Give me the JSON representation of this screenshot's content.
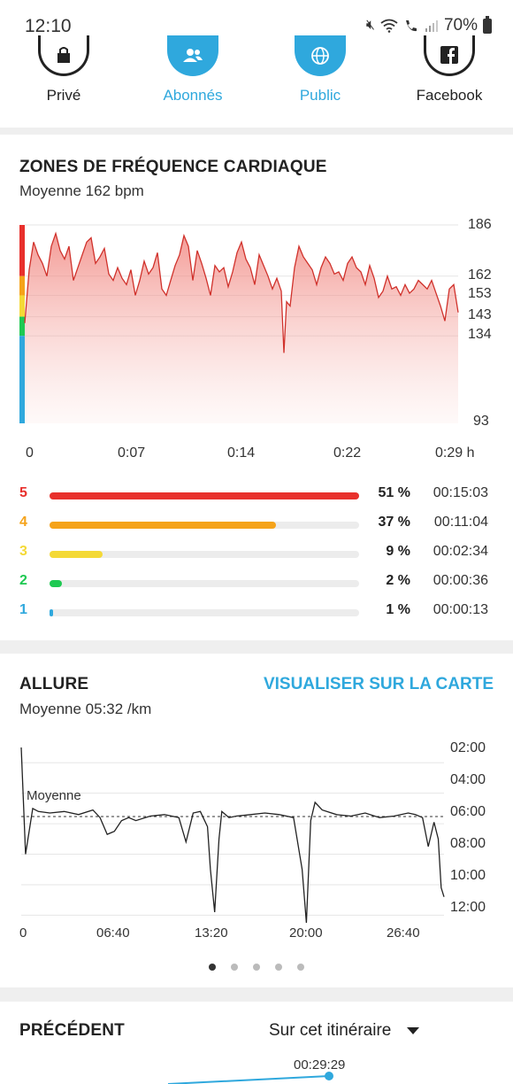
{
  "status": {
    "time": "12:10",
    "battery": "70%"
  },
  "share": {
    "items": [
      {
        "label": "Privé",
        "color": "#222222"
      },
      {
        "label": "Abonnés",
        "color": "#2fa8dd"
      },
      {
        "label": "Public",
        "color": "#2fa8dd"
      },
      {
        "label": "Facebook",
        "color": "#222222"
      }
    ]
  },
  "heart_rate": {
    "title": "ZONES DE FRÉQUENCE CARDIAQUE",
    "subtitle": "Moyenne 162 bpm",
    "y_ticks": [
      "186",
      "162",
      "153",
      "143",
      "134",
      "93"
    ],
    "x_ticks": [
      "0",
      "0:07",
      "0:14",
      "0:22",
      "0:29 h"
    ],
    "zones": [
      {
        "num": "5",
        "pct": "51 %",
        "time": "00:15:03",
        "fraction": 1.0,
        "color": "#e8302c"
      },
      {
        "num": "4",
        "pct": "37 %",
        "time": "00:11:04",
        "fraction": 0.73,
        "color": "#f5a31a"
      },
      {
        "num": "3",
        "pct": "9 %",
        "time": "00:02:34",
        "fraction": 0.17,
        "color": "#f4d936"
      },
      {
        "num": "2",
        "pct": "2 %",
        "time": "00:00:36",
        "fraction": 0.04,
        "color": "#1ec952"
      },
      {
        "num": "1",
        "pct": "1 %",
        "time": "00:00:13",
        "fraction": 0.01,
        "color": "#2fa8dd"
      }
    ]
  },
  "pace": {
    "title": "ALLURE",
    "link": "VISUALISER SUR LA CARTE",
    "subtitle": "Moyenne 05:32 /km",
    "avg_label": "Moyenne",
    "y_ticks": [
      "02:00",
      "04:00",
      "06:00",
      "08:00",
      "10:00",
      "12:00"
    ],
    "x_ticks": [
      "0",
      "06:40",
      "13:20",
      "20:00",
      "26:40"
    ]
  },
  "previous": {
    "title": "PRÉCÉDENT",
    "selector": "Sur cet itinéraire",
    "time": "00:29:29"
  },
  "carousel": {
    "count": 5,
    "active": 0
  },
  "chart_data": [
    {
      "type": "area",
      "title": "ZONES DE FRÉQUENCE CARDIAQUE",
      "xlabel": "",
      "ylabel": "",
      "x_unit": "h",
      "ylim": [
        93,
        186
      ],
      "xlim": [
        0,
        0.49
      ],
      "series": [
        {
          "x": [
            0,
            0.005,
            0.01,
            0.015,
            0.02,
            0.025,
            0.03,
            0.035,
            0.04,
            0.045,
            0.05,
            0.055,
            0.06,
            0.065,
            0.07,
            0.075,
            0.08,
            0.085,
            0.09,
            0.095,
            0.1,
            0.105,
            0.11,
            0.115,
            0.12,
            0.125,
            0.13,
            0.135,
            0.14,
            0.145,
            0.15,
            0.155,
            0.16,
            0.165,
            0.17,
            0.175,
            0.18,
            0.185,
            0.19,
            0.195,
            0.2,
            0.205,
            0.21,
            0.215,
            0.22,
            0.225,
            0.23,
            0.235,
            0.24,
            0.245,
            0.25,
            0.255,
            0.26,
            0.265,
            0.27,
            0.275,
            0.28,
            0.285,
            0.29,
            0.293,
            0.296,
            0.3,
            0.305,
            0.31,
            0.315,
            0.32,
            0.325,
            0.33,
            0.335,
            0.34,
            0.345,
            0.35,
            0.355,
            0.36,
            0.365,
            0.37,
            0.375,
            0.38,
            0.385,
            0.39,
            0.395,
            0.4,
            0.405,
            0.41,
            0.415,
            0.42,
            0.425,
            0.43,
            0.435,
            0.44,
            0.445,
            0.45,
            0.455,
            0.46,
            0.465,
            0.47,
            0.475,
            0.48,
            0.485,
            0.49
          ],
          "values": [
            140,
            165,
            178,
            172,
            168,
            162,
            176,
            182,
            174,
            170,
            176,
            160,
            166,
            172,
            178,
            180,
            168,
            171,
            175,
            163,
            160,
            166,
            161,
            158,
            165,
            153,
            160,
            169,
            163,
            166,
            173,
            156,
            153,
            160,
            167,
            172,
            181,
            176,
            160,
            174,
            168,
            161,
            153,
            167,
            164,
            166,
            157,
            164,
            173,
            178,
            170,
            166,
            158,
            172,
            167,
            162,
            156,
            161,
            155,
            126,
            150,
            148,
            166,
            176,
            171,
            168,
            165,
            158,
            166,
            171,
            168,
            163,
            164,
            160,
            168,
            171,
            166,
            164,
            158,
            167,
            161,
            152,
            155,
            162,
            156,
            157,
            153,
            158,
            154,
            156,
            160,
            158,
            156,
            160,
            154,
            148,
            141,
            156,
            158,
            145
          ]
        }
      ]
    },
    {
      "type": "line",
      "title": "ALLURE",
      "xlabel": "",
      "ylabel": "",
      "ylim": [
        "01:00",
        "13:00"
      ],
      "xlim": [
        "0",
        "29:29"
      ],
      "average": "05:32",
      "y_reversed": true,
      "series": [
        {
          "x_minutes": [
            0,
            0.3,
            0.8,
            1.2,
            2,
            3,
            4,
            5,
            5.5,
            6,
            6.5,
            7,
            7.5,
            8,
            9,
            10,
            11,
            11.5,
            12,
            12.5,
            13,
            13.2,
            13.5,
            13.8,
            14,
            14.5,
            15,
            16,
            17,
            18,
            19,
            19.6,
            19.9,
            20.2,
            20.5,
            21,
            22,
            23,
            24,
            25,
            26,
            27,
            27.5,
            28,
            28.4,
            28.8,
            29.1,
            29.3,
            29.5
          ],
          "pace_minutes": [
            1,
            8,
            5,
            5.2,
            5.3,
            5.2,
            5.4,
            5.1,
            5.6,
            6.7,
            6.5,
            5.8,
            5.6,
            5.8,
            5.5,
            5.4,
            5.6,
            7.2,
            5.3,
            5.2,
            6.2,
            9,
            11.8,
            7,
            5.2,
            5.6,
            5.5,
            5.4,
            5.3,
            5.4,
            5.6,
            9,
            12.5,
            5.8,
            4.6,
            5.1,
            5.4,
            5.5,
            5.3,
            5.6,
            5.5,
            5.3,
            5.4,
            5.6,
            7.5,
            5.9,
            7,
            10.2,
            10.8
          ]
        }
      ]
    }
  ]
}
